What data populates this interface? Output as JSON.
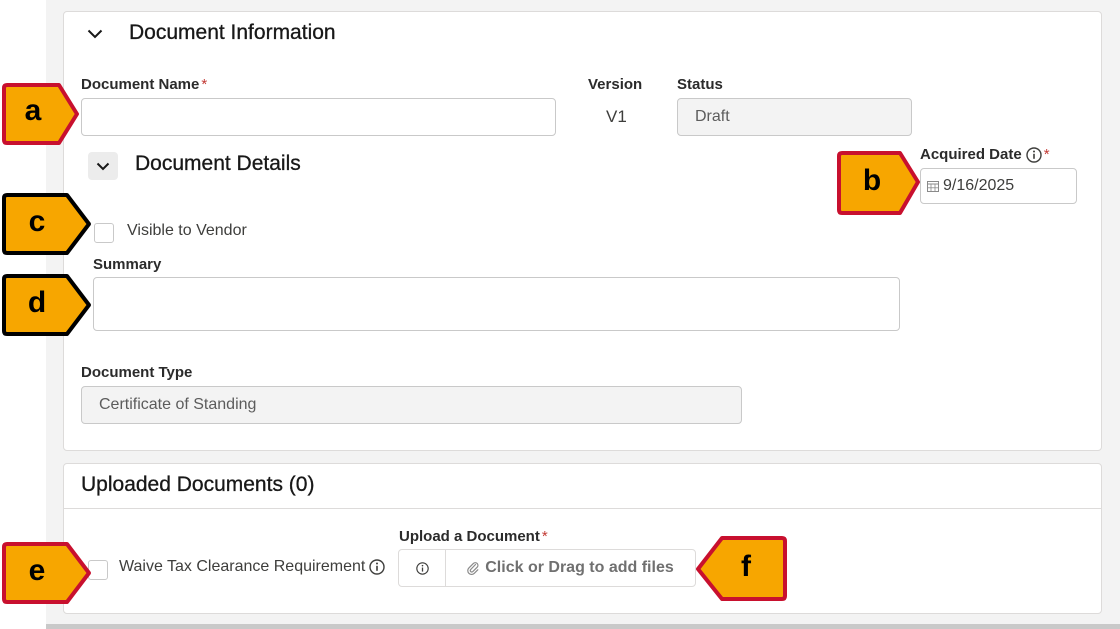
{
  "document_information": {
    "title": "Document Information",
    "document_name": {
      "label": "Document Name",
      "required_mark": "*",
      "value": ""
    },
    "version": {
      "label": "Version",
      "value": "V1"
    },
    "status": {
      "label": "Status",
      "value": "Draft"
    }
  },
  "document_details": {
    "title": "Document Details",
    "acquired_date": {
      "label": "Acquired Date",
      "required_mark": "*",
      "value": "9/16/2025"
    },
    "visible_to_vendor": {
      "label": "Visible to Vendor",
      "checked": false
    },
    "summary": {
      "label": "Summary",
      "value": ""
    },
    "document_type": {
      "label": "Document Type",
      "value": "Certificate of Standing"
    }
  },
  "uploaded_documents": {
    "title": "Uploaded Documents (0)",
    "waive_tax": {
      "label": "Waive Tax Clearance Requirement",
      "checked": false
    },
    "upload": {
      "label": "Upload a Document",
      "required_mark": "*",
      "dropzone_text": "Click or Drag to add files"
    }
  },
  "callouts": {
    "a": "a",
    "b": "b",
    "c": "c",
    "d": "d",
    "e": "e",
    "f": "f"
  },
  "colors": {
    "callout_fill": "#f7a600",
    "callout_border_red": "#c8102e",
    "callout_border_black": "#000000",
    "required": "#c23934"
  },
  "icons": {
    "section_toggle": "chevron-down-icon",
    "info": "info-icon",
    "calendar": "calendar-icon",
    "attachment": "paperclip-icon"
  }
}
